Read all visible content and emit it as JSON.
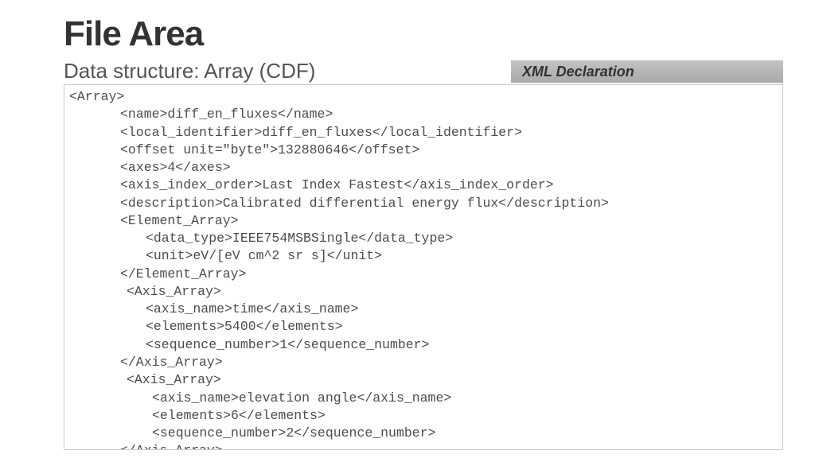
{
  "title": "File Area",
  "subtitle": "Data structure: Array (CDF)",
  "xml_declaration_label": "XML Declaration",
  "code_lines": [
    {
      "indent": "i1",
      "text": "<Array>"
    },
    {
      "indent": "i2",
      "text": "<name>diff_en_fluxes</name>"
    },
    {
      "indent": "i2",
      "text": "<local_identifier>diff_en_fluxes</local_identifier>"
    },
    {
      "indent": "i2",
      "text": "<offset unit=\"byte\">132880646</offset>"
    },
    {
      "indent": "i2",
      "text": "<axes>4</axes>"
    },
    {
      "indent": "i2",
      "text": "<axis_index_order>Last Index Fastest</axis_index_order>"
    },
    {
      "indent": "i2",
      "text": "<description>Calibrated differential energy flux</description>"
    },
    {
      "indent": "i2",
      "text": "<Element_Array>"
    },
    {
      "indent": "i4",
      "text": "<data_type>IEEE754MSBSingle</data_type>"
    },
    {
      "indent": "i4",
      "text": "<unit>eV/[eV cm^2 sr s]</unit>"
    },
    {
      "indent": "i2",
      "text": "</Element_Array>"
    },
    {
      "indent": "i3",
      "text": "<Axis_Array>"
    },
    {
      "indent": "i4",
      "text": "<axis_name>time</axis_name>"
    },
    {
      "indent": "i4",
      "text": "<elements>5400</elements>"
    },
    {
      "indent": "i4",
      "text": "<sequence_number>1</sequence_number>"
    },
    {
      "indent": "i2",
      "text": "</Axis_Array>"
    },
    {
      "indent": "i3",
      "text": "<Axis_Array>"
    },
    {
      "indent": "i5",
      "text": "<axis_name>elevation angle</axis_name>"
    },
    {
      "indent": "i5",
      "text": "<elements>6</elements>"
    },
    {
      "indent": "i5",
      "text": "<sequence_number>2</sequence_number>"
    },
    {
      "indent": "i2",
      "text": "</Axis_Array>"
    }
  ]
}
